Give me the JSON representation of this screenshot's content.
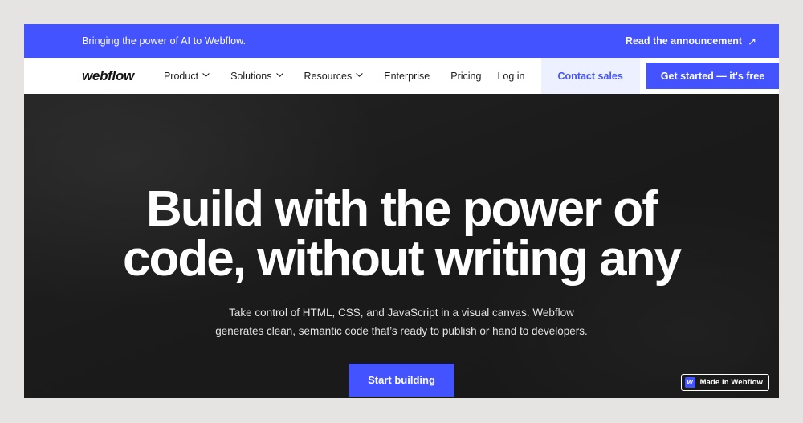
{
  "banner": {
    "message": "Bringing the power of AI to Webflow.",
    "link_label": "Read the announcement",
    "link_icon": "arrow-up-right-icon",
    "background_color": "#4353ff",
    "text_color": "#ffffff"
  },
  "nav": {
    "logo": "webflow",
    "items": [
      {
        "label": "Product",
        "has_dropdown": true
      },
      {
        "label": "Solutions",
        "has_dropdown": true
      },
      {
        "label": "Resources",
        "has_dropdown": true
      },
      {
        "label": "Enterprise",
        "has_dropdown": false
      },
      {
        "label": "Pricing",
        "has_dropdown": false
      }
    ],
    "login_label": "Log in",
    "contact_label": "Contact sales",
    "get_started_label": "Get started — it's free",
    "contact_bg_color": "#edf0ff",
    "contact_text_color": "#4353ff",
    "get_started_bg_color": "#4353ff"
  },
  "hero": {
    "headline": "Build with the power of code, without writing any",
    "subhead": "Take control of HTML, CSS, and JavaScript in a visual canvas. Webflow generates clean, semantic code that’s ready to publish or hand to developers.",
    "cta_label": "Start building",
    "cta_color": "#4353ff",
    "background_color": "#1b1b1b",
    "text_color": "#ffffff"
  },
  "badge": {
    "icon_letter": "W",
    "label": "Made in Webflow",
    "icon_color": "#4353ff",
    "background_color": "#1a1a1a"
  }
}
